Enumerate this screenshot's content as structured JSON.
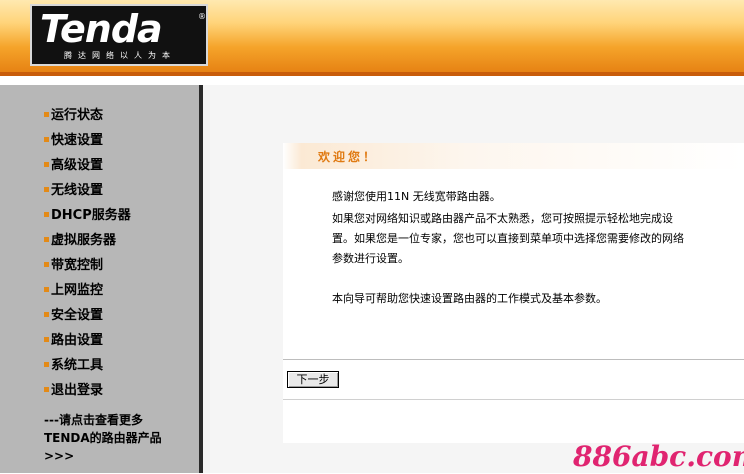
{
  "header": {
    "logo_text": "Tenda",
    "logo_reg": "®",
    "slogan": "腾达网络以人为本",
    "accent_color": "#e47d10"
  },
  "sidebar": {
    "items": [
      {
        "label": "运行状态"
      },
      {
        "label": "快速设置"
      },
      {
        "label": "高级设置"
      },
      {
        "label": "无线设置"
      },
      {
        "label": "DHCP服务器"
      },
      {
        "label": "虚拟服务器"
      },
      {
        "label": "带宽控制"
      },
      {
        "label": "上网监控"
      },
      {
        "label": "安全设置"
      },
      {
        "label": "路由设置"
      },
      {
        "label": "系统工具"
      },
      {
        "label": "退出登录"
      }
    ],
    "more_line1": "---请点击查看更多",
    "more_line2": "TENDA的路由器产品",
    "more_line3": ">>>"
  },
  "main": {
    "welcome_title": "欢迎您！",
    "para1": "感谢您使用11N 无线宽带路由器。",
    "para2_line1": "如果您对网络知识或路由器产品不太熟悉，您可按照提示轻松地完成设",
    "para2_line2": "置。如果您是一位专家，您也可以直接到菜单项中选择您需要修改的网络",
    "para2_line3": "参数进行设置。",
    "para3": "本向导可帮助您快速设置路由器的工作模式及基本参数。",
    "next_button": "下一步"
  },
  "watermark": {
    "text": "886abc.com",
    "color": "#e02470"
  }
}
